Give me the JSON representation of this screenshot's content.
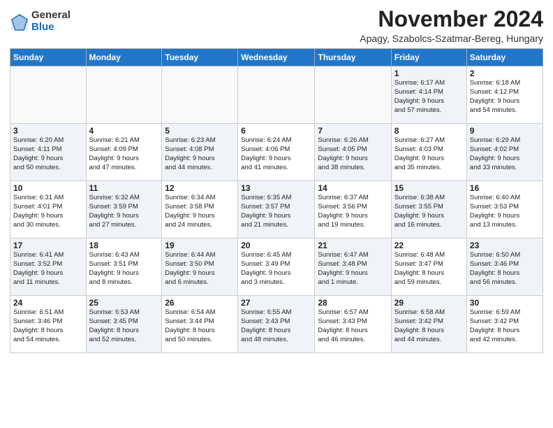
{
  "header": {
    "logo_general": "General",
    "logo_blue": "Blue",
    "month_title": "November 2024",
    "location": "Apagy, Szabolcs-Szatmar-Bereg, Hungary"
  },
  "columns": [
    "Sunday",
    "Monday",
    "Tuesday",
    "Wednesday",
    "Thursday",
    "Friday",
    "Saturday"
  ],
  "weeks": [
    [
      {
        "day": "",
        "info": "",
        "empty": true
      },
      {
        "day": "",
        "info": "",
        "empty": true
      },
      {
        "day": "",
        "info": "",
        "empty": true
      },
      {
        "day": "",
        "info": "",
        "empty": true
      },
      {
        "day": "",
        "info": "",
        "empty": true
      },
      {
        "day": "1",
        "info": "Sunrise: 6:17 AM\nSunset: 4:14 PM\nDaylight: 9 hours\nand 57 minutes.",
        "shaded": true
      },
      {
        "day": "2",
        "info": "Sunrise: 6:18 AM\nSunset: 4:12 PM\nDaylight: 9 hours\nand 54 minutes.",
        "shaded": false
      }
    ],
    [
      {
        "day": "3",
        "info": "Sunrise: 6:20 AM\nSunset: 4:11 PM\nDaylight: 9 hours\nand 50 minutes.",
        "shaded": true
      },
      {
        "day": "4",
        "info": "Sunrise: 6:21 AM\nSunset: 4:09 PM\nDaylight: 9 hours\nand 47 minutes.",
        "shaded": false
      },
      {
        "day": "5",
        "info": "Sunrise: 6:23 AM\nSunset: 4:08 PM\nDaylight: 9 hours\nand 44 minutes.",
        "shaded": true
      },
      {
        "day": "6",
        "info": "Sunrise: 6:24 AM\nSunset: 4:06 PM\nDaylight: 9 hours\nand 41 minutes.",
        "shaded": false
      },
      {
        "day": "7",
        "info": "Sunrise: 6:26 AM\nSunset: 4:05 PM\nDaylight: 9 hours\nand 38 minutes.",
        "shaded": true
      },
      {
        "day": "8",
        "info": "Sunrise: 6:27 AM\nSunset: 4:03 PM\nDaylight: 9 hours\nand 35 minutes.",
        "shaded": false
      },
      {
        "day": "9",
        "info": "Sunrise: 6:29 AM\nSunset: 4:02 PM\nDaylight: 9 hours\nand 33 minutes.",
        "shaded": true
      }
    ],
    [
      {
        "day": "10",
        "info": "Sunrise: 6:31 AM\nSunset: 4:01 PM\nDaylight: 9 hours\nand 30 minutes.",
        "shaded": false
      },
      {
        "day": "11",
        "info": "Sunrise: 6:32 AM\nSunset: 3:59 PM\nDaylight: 9 hours\nand 27 minutes.",
        "shaded": true
      },
      {
        "day": "12",
        "info": "Sunrise: 6:34 AM\nSunset: 3:58 PM\nDaylight: 9 hours\nand 24 minutes.",
        "shaded": false
      },
      {
        "day": "13",
        "info": "Sunrise: 6:35 AM\nSunset: 3:57 PM\nDaylight: 9 hours\nand 21 minutes.",
        "shaded": true
      },
      {
        "day": "14",
        "info": "Sunrise: 6:37 AM\nSunset: 3:56 PM\nDaylight: 9 hours\nand 19 minutes.",
        "shaded": false
      },
      {
        "day": "15",
        "info": "Sunrise: 6:38 AM\nSunset: 3:55 PM\nDaylight: 9 hours\nand 16 minutes.",
        "shaded": true
      },
      {
        "day": "16",
        "info": "Sunrise: 6:40 AM\nSunset: 3:53 PM\nDaylight: 9 hours\nand 13 minutes.",
        "shaded": false
      }
    ],
    [
      {
        "day": "17",
        "info": "Sunrise: 6:41 AM\nSunset: 3:52 PM\nDaylight: 9 hours\nand 11 minutes.",
        "shaded": true
      },
      {
        "day": "18",
        "info": "Sunrise: 6:43 AM\nSunset: 3:51 PM\nDaylight: 9 hours\nand 8 minutes.",
        "shaded": false
      },
      {
        "day": "19",
        "info": "Sunrise: 6:44 AM\nSunset: 3:50 PM\nDaylight: 9 hours\nand 6 minutes.",
        "shaded": true
      },
      {
        "day": "20",
        "info": "Sunrise: 6:45 AM\nSunset: 3:49 PM\nDaylight: 9 hours\nand 3 minutes.",
        "shaded": false
      },
      {
        "day": "21",
        "info": "Sunrise: 6:47 AM\nSunset: 3:48 PM\nDaylight: 9 hours\nand 1 minute.",
        "shaded": true
      },
      {
        "day": "22",
        "info": "Sunrise: 6:48 AM\nSunset: 3:47 PM\nDaylight: 8 hours\nand 59 minutes.",
        "shaded": false
      },
      {
        "day": "23",
        "info": "Sunrise: 6:50 AM\nSunset: 3:46 PM\nDaylight: 8 hours\nand 56 minutes.",
        "shaded": true
      }
    ],
    [
      {
        "day": "24",
        "info": "Sunrise: 6:51 AM\nSunset: 3:46 PM\nDaylight: 8 hours\nand 54 minutes.",
        "shaded": false
      },
      {
        "day": "25",
        "info": "Sunrise: 6:53 AM\nSunset: 3:45 PM\nDaylight: 8 hours\nand 52 minutes.",
        "shaded": true
      },
      {
        "day": "26",
        "info": "Sunrise: 6:54 AM\nSunset: 3:44 PM\nDaylight: 8 hours\nand 50 minutes.",
        "shaded": false
      },
      {
        "day": "27",
        "info": "Sunrise: 6:55 AM\nSunset: 3:43 PM\nDaylight: 8 hours\nand 48 minutes.",
        "shaded": true
      },
      {
        "day": "28",
        "info": "Sunrise: 6:57 AM\nSunset: 3:43 PM\nDaylight: 8 hours\nand 46 minutes.",
        "shaded": false
      },
      {
        "day": "29",
        "info": "Sunrise: 6:58 AM\nSunset: 3:42 PM\nDaylight: 8 hours\nand 44 minutes.",
        "shaded": true
      },
      {
        "day": "30",
        "info": "Sunrise: 6:59 AM\nSunset: 3:42 PM\nDaylight: 8 hours\nand 42 minutes.",
        "shaded": false
      }
    ]
  ]
}
